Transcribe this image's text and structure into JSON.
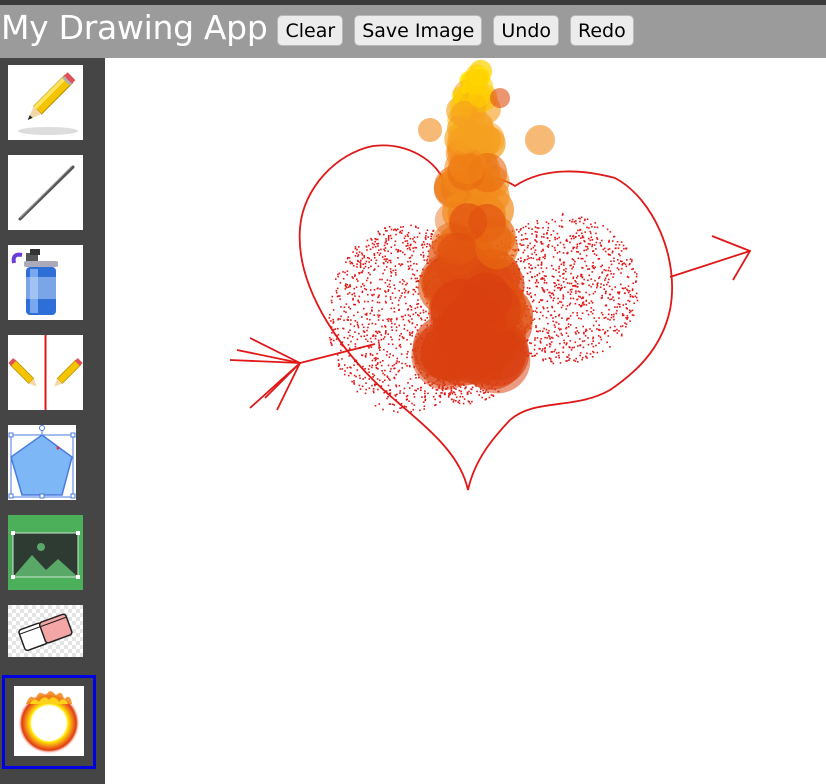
{
  "app": {
    "title": "My Drawing App"
  },
  "toolbar": {
    "clear_label": "Clear",
    "save_label": "Save Image",
    "undo_label": "Undo",
    "redo_label": "Redo"
  },
  "tools": [
    {
      "icon": "pencil-icon",
      "selected": false
    },
    {
      "icon": "line-icon",
      "selected": false
    },
    {
      "icon": "spray-can-icon",
      "selected": false
    },
    {
      "icon": "mirror-pencil-icon",
      "selected": false
    },
    {
      "icon": "polygon-shape-icon",
      "selected": false
    },
    {
      "icon": "image-icon",
      "selected": false
    },
    {
      "icon": "eraser-icon",
      "selected": false
    },
    {
      "icon": "fire-ring-icon",
      "selected": true
    }
  ],
  "colors": {
    "toolbar_bg": "#9b9b9b",
    "sidebar_bg": "#454545",
    "selection_border": "#0000e0",
    "stroke": "#e01818",
    "fire_orange": "#f28a1a",
    "fire_yellow": "#ffe800"
  }
}
